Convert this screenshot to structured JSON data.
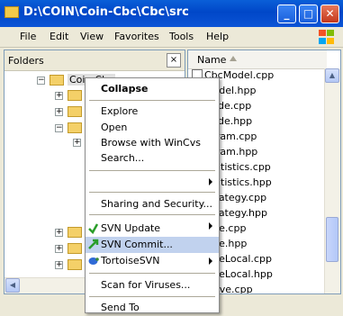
{
  "window": {
    "title": "D:\\COIN\\Coin-Cbc\\Cbc\\src"
  },
  "title_buttons": {
    "minimize": "_",
    "maximize": "□",
    "close": "✕"
  },
  "menubar": {
    "items": [
      "File",
      "Edit",
      "View",
      "Favorites",
      "Tools",
      "Help"
    ]
  },
  "folders_pane": {
    "label": "Folders",
    "close": "×",
    "selected_node": "Coin-Cbc"
  },
  "list": {
    "column_header": "Name",
    "files": [
      "CbcModel.cpp",
      "Model.hpp",
      "Node.cpp",
      "Node.hpp",
      "Param.cpp",
      "Param.hpp",
      "Statistics.cpp",
      "Statistics.hpp",
      "Strategy.cpp",
      "Strategy.hpp",
      "Tree.cpp",
      "Tree.hpp",
      "TreeLocal.cpp",
      "TreeLocal.hpp",
      "Solve.cpp"
    ]
  },
  "context_menu": {
    "items": [
      {
        "label": "Collapse"
      },
      {
        "label": "Explore"
      },
      {
        "label": "Open"
      },
      {
        "label": "Browse with WinCvs"
      },
      {
        "label": "Search..."
      },
      {
        "label": ""
      },
      {
        "label": "Sharing and Security..."
      },
      {
        "label": ""
      },
      {
        "label": "SVN Update"
      },
      {
        "label": "SVN Commit..."
      },
      {
        "label": "TortoiseSVN"
      },
      {
        "label": "Scan for Viruses..."
      },
      {
        "label": "Send To"
      }
    ],
    "highlighted": "SVN Commit..."
  }
}
